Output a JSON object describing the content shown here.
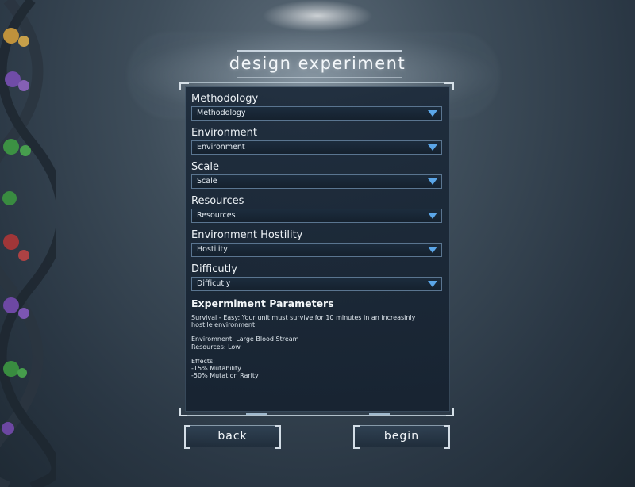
{
  "title": "design experiment",
  "fields": [
    {
      "label": "Methodology",
      "value": "Methodology"
    },
    {
      "label": "Environment",
      "value": "Environment"
    },
    {
      "label": "Scale",
      "value": "Scale"
    },
    {
      "label": "Resources",
      "value": "Resources"
    },
    {
      "label": "Environment Hostility",
      "value": "Hostility"
    },
    {
      "label": "Difficutly",
      "value": "Difficutly"
    }
  ],
  "parameters": {
    "title": "Expermiment Parameters",
    "description": "Survival - Easy: Your unit must survive for 10 minutes in an increasinly hostile environment.",
    "environment": "Enviromnent: Large Blood Stream",
    "resources": "Resources: Low",
    "effects_label": "Effects:",
    "effect_1": "-15% Mutability",
    "effect_2": "-50% Mutation Rarity"
  },
  "buttons": {
    "back": "back",
    "begin": "begin"
  },
  "colors": {
    "accent": "#5ba6e8",
    "panel": "#1c2a3a"
  },
  "icons": {
    "dropdown": "chevron-down-icon"
  }
}
